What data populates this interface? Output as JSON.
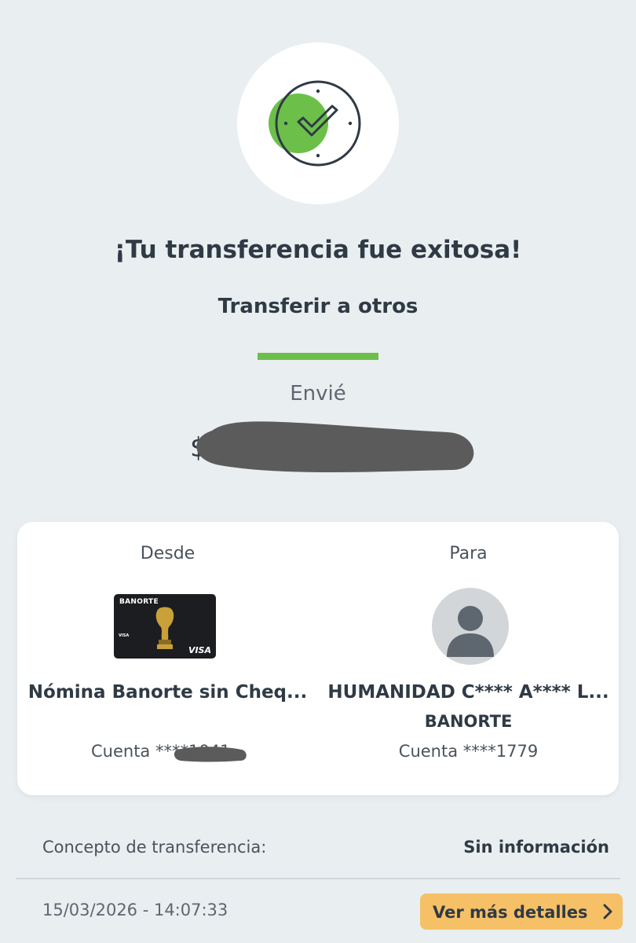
{
  "header": {
    "title": "¡Tu transferencia fue exitosa!",
    "subtitle": "Transferir a otros",
    "sent_label": "Envié",
    "amount": "$"
  },
  "transfer": {
    "from": {
      "heading": "Desde",
      "card_brand": "BANORTE",
      "card_network": "VISA",
      "account_name": "Nómina Banorte sin Cheq...",
      "account_number": "Cuenta ****1041"
    },
    "to": {
      "heading": "Para",
      "account_name": "HUMANIDAD C**** A**** L...",
      "bank": "BANORTE",
      "account_number": "Cuenta ****1779"
    }
  },
  "concept": {
    "label": "Concepto de transferencia:",
    "value": "Sin información"
  },
  "footer": {
    "timestamp": "15/03/2026 - 14:07:33",
    "details_button": "Ver más detalles"
  },
  "icons": {
    "success": "check-clock-icon",
    "avatar": "user-avatar-icon",
    "chevron": "chevron-right-icon"
  },
  "colors": {
    "accent_green": "#6cc04a",
    "button_yellow": "#f6c067",
    "text_dark": "#2f3a45",
    "background": "#e9eef0"
  }
}
